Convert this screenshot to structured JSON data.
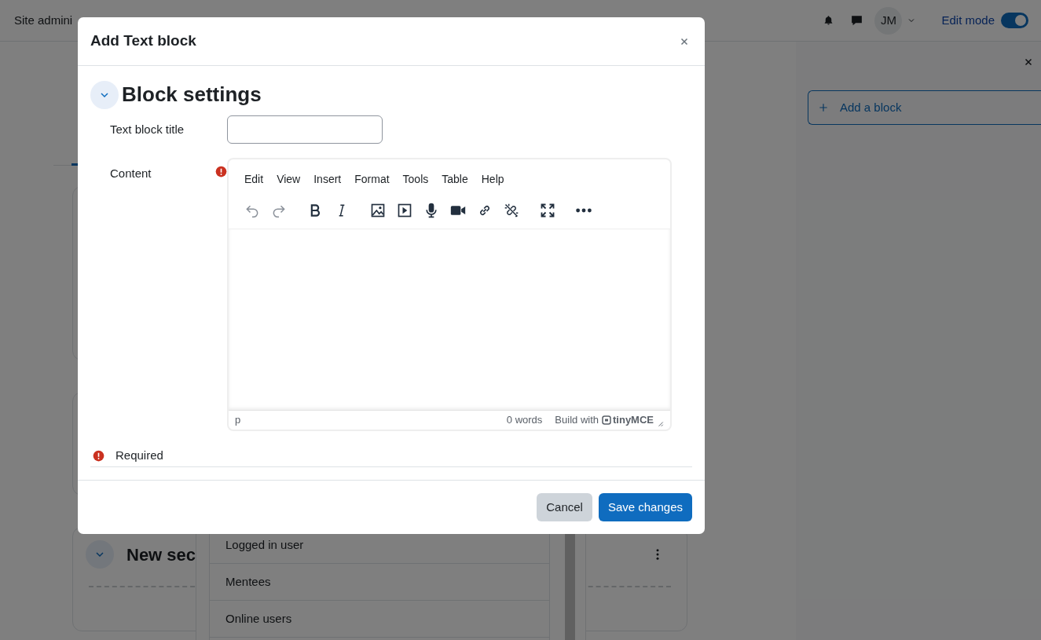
{
  "navbar": {
    "items": [
      "Site admini"
    ],
    "avatar_initials": "JM",
    "edit_mode": {
      "label": "Edit mode",
      "on": true
    }
  },
  "page": {
    "section": {
      "title": "New sec",
      "expanded": true
    }
  },
  "block_drawer": {
    "add_block_label": "Add a block"
  },
  "dropdown": {
    "items": [
      "Logged in user",
      "Mentees",
      "Online users"
    ]
  },
  "modal": {
    "title": "Add Text block",
    "section": {
      "title": "Block settings",
      "expanded": true
    },
    "title_field": {
      "label": "Text block title"
    },
    "content_field": {
      "label": "Content",
      "required": true,
      "menu": [
        "Edit",
        "View",
        "Insert",
        "Format",
        "Tools",
        "Table",
        "Help"
      ],
      "toolbar": [
        [
          {
            "kind": "undo",
            "disabled": true
          },
          {
            "kind": "redo",
            "disabled": true
          }
        ],
        [
          {
            "kind": "bold",
            "disabled": false
          },
          {
            "kind": "italic",
            "disabled": false
          }
        ],
        [
          {
            "kind": "image",
            "disabled": false
          },
          {
            "kind": "media",
            "disabled": false
          },
          {
            "kind": "mic",
            "disabled": false
          },
          {
            "kind": "video",
            "disabled": false
          },
          {
            "kind": "link",
            "disabled": false
          },
          {
            "kind": "unlink",
            "disabled": false
          }
        ],
        [
          {
            "kind": "fullscreen",
            "disabled": false
          }
        ],
        [
          {
            "kind": "more",
            "disabled": false
          }
        ]
      ],
      "path": "p",
      "word_count": "0 words",
      "branding": "Build with",
      "brand": "tinyMCE"
    },
    "required_note": "Required",
    "buttons": [
      {
        "label": "Cancel",
        "kind": "secondary"
      },
      {
        "label": "Save changes",
        "kind": "primary"
      }
    ]
  }
}
